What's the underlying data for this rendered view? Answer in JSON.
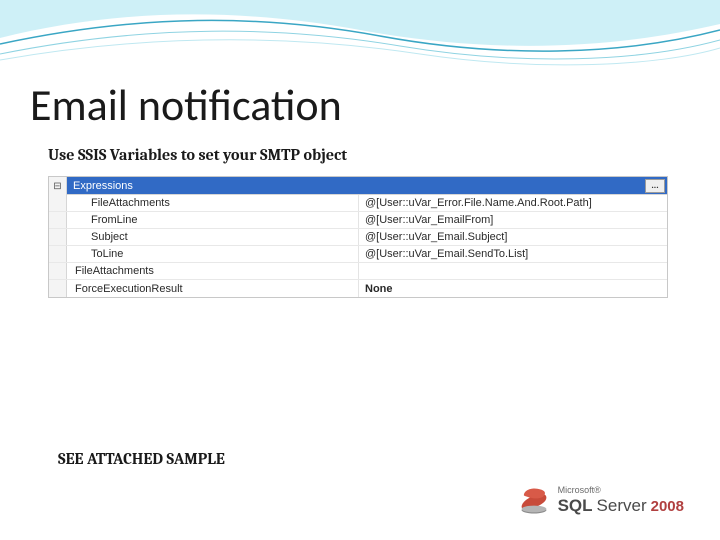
{
  "slide": {
    "title": "Email notification",
    "subtitle": "Use SSIS Variables to set your SMTP object",
    "footer_note": "SEE ATTACHED SAMPLE"
  },
  "grid": {
    "header_label": "Expressions",
    "expand_glyph": "⊟",
    "ellipsis_label": "...",
    "rows": [
      {
        "name": "FileAttachments",
        "value": "@[User::uVar_Error.File.Name.And.Root.Path]",
        "indent": true,
        "bold": false
      },
      {
        "name": "FromLine",
        "value": "@[User::uVar_EmailFrom]",
        "indent": true,
        "bold": false
      },
      {
        "name": "Subject",
        "value": "@[User::uVar_Email.Subject]",
        "indent": true,
        "bold": false
      },
      {
        "name": "ToLine",
        "value": "@[User::uVar_Email.SendTo.List]",
        "indent": true,
        "bold": false
      },
      {
        "name": "FileAttachments",
        "value": "",
        "indent": false,
        "bold": false
      },
      {
        "name": "ForceExecutionResult",
        "value": "None",
        "indent": false,
        "bold": true
      }
    ]
  },
  "logo": {
    "vendor": "Microsoft®",
    "product_a": "SQL",
    "product_b": "Server",
    "year": "2008"
  },
  "colors": {
    "selection": "#316ac5",
    "accent": "#3aa6c4",
    "year": "#b14040"
  }
}
